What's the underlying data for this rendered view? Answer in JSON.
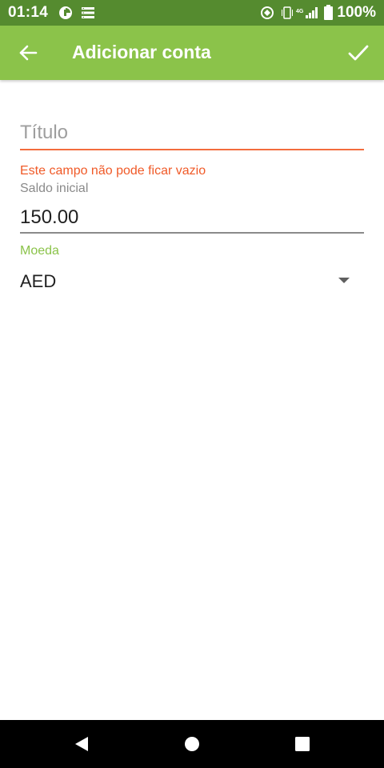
{
  "status_bar": {
    "time": "01:14",
    "battery": "100%",
    "icons": [
      "data-saver-icon",
      "storage-icon",
      "sync-icon",
      "vibrate-icon",
      "signal-4g-icon",
      "battery-icon"
    ]
  },
  "app_bar": {
    "title": "Adicionar conta",
    "back_icon": "arrow-left-icon",
    "confirm_icon": "check-icon"
  },
  "form": {
    "title_field": {
      "placeholder": "Título",
      "value": "",
      "error": "Este campo não pode ficar vazio"
    },
    "balance_field": {
      "label": "Saldo inicial",
      "value": "150.00"
    },
    "currency_field": {
      "label": "Moeda",
      "selected": "AED"
    }
  },
  "nav_bar": {
    "icons": [
      "back-triangle-icon",
      "home-circle-icon",
      "recents-square-icon"
    ]
  },
  "colors": {
    "status_bar": "#558b2f",
    "app_bar": "#8bc34a",
    "error": "#f05a28",
    "accent": "#8bc34a"
  }
}
